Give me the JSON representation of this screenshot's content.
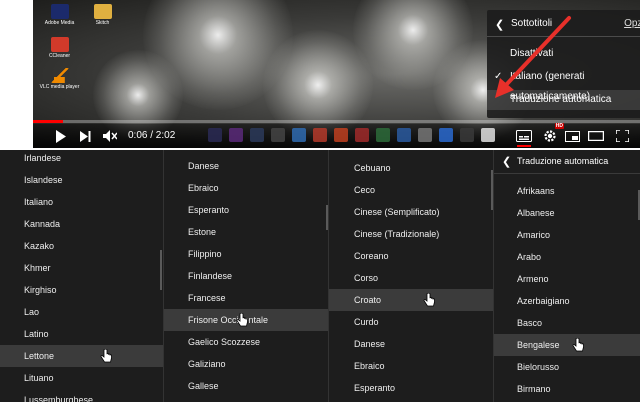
{
  "player": {
    "time": "0:06 / 2:02",
    "progress": 0.05,
    "accent": "#ff0000",
    "hd_badge": "HD"
  },
  "desktop_icons": [
    {
      "label": "Adobe Media",
      "color": "#1b2a6b"
    },
    {
      "label": "CCleaner",
      "color": "#d23a2a"
    },
    {
      "label": "VLC media player",
      "color": "#f08a00"
    },
    {
      "label": "Skitch",
      "color": "#e0b040"
    }
  ],
  "settings_menu": {
    "title": "Sottotitoli",
    "options_link": "Opzioni",
    "items": [
      "Disattivati",
      "Italiano (generati automaticamente)",
      "Traduzione automatica"
    ],
    "selected_index": 1
  },
  "annotation_arrow_color": "#e8302a",
  "panel1": {
    "items": [
      "Irlandese",
      "Islandese",
      "Italiano",
      "Kannada",
      "Kazako",
      "Khmer",
      "Kirghiso",
      "Lao",
      "Latino",
      "Lettone",
      "Lituano",
      "Lussemburghese"
    ],
    "highlighted": 9
  },
  "panel2": {
    "items": [
      "Danese",
      "Ebraico",
      "Esperanto",
      "Estone",
      "Filippino",
      "Finlandese",
      "Francese",
      "Frisone Occidentale",
      "Gaelico Scozzese",
      "Galiziano",
      "Gallese"
    ],
    "highlighted": 7
  },
  "panel3": {
    "items": [
      "Cebuano",
      "Ceco",
      "Cinese (Semplificato)",
      "Cinese (Tradizionale)",
      "Coreano",
      "Corso",
      "Croato",
      "Curdo",
      "Danese",
      "Ebraico",
      "Esperanto"
    ],
    "highlighted": 6
  },
  "panel4": {
    "title": "Traduzione automatica",
    "items": [
      "Afrikaans",
      "Albanese",
      "Amarico",
      "Arabo",
      "Armeno",
      "Azerbaigiano",
      "Basco",
      "Bengalese",
      "Bielorusso",
      "Birmano"
    ],
    "highlighted": 7
  }
}
